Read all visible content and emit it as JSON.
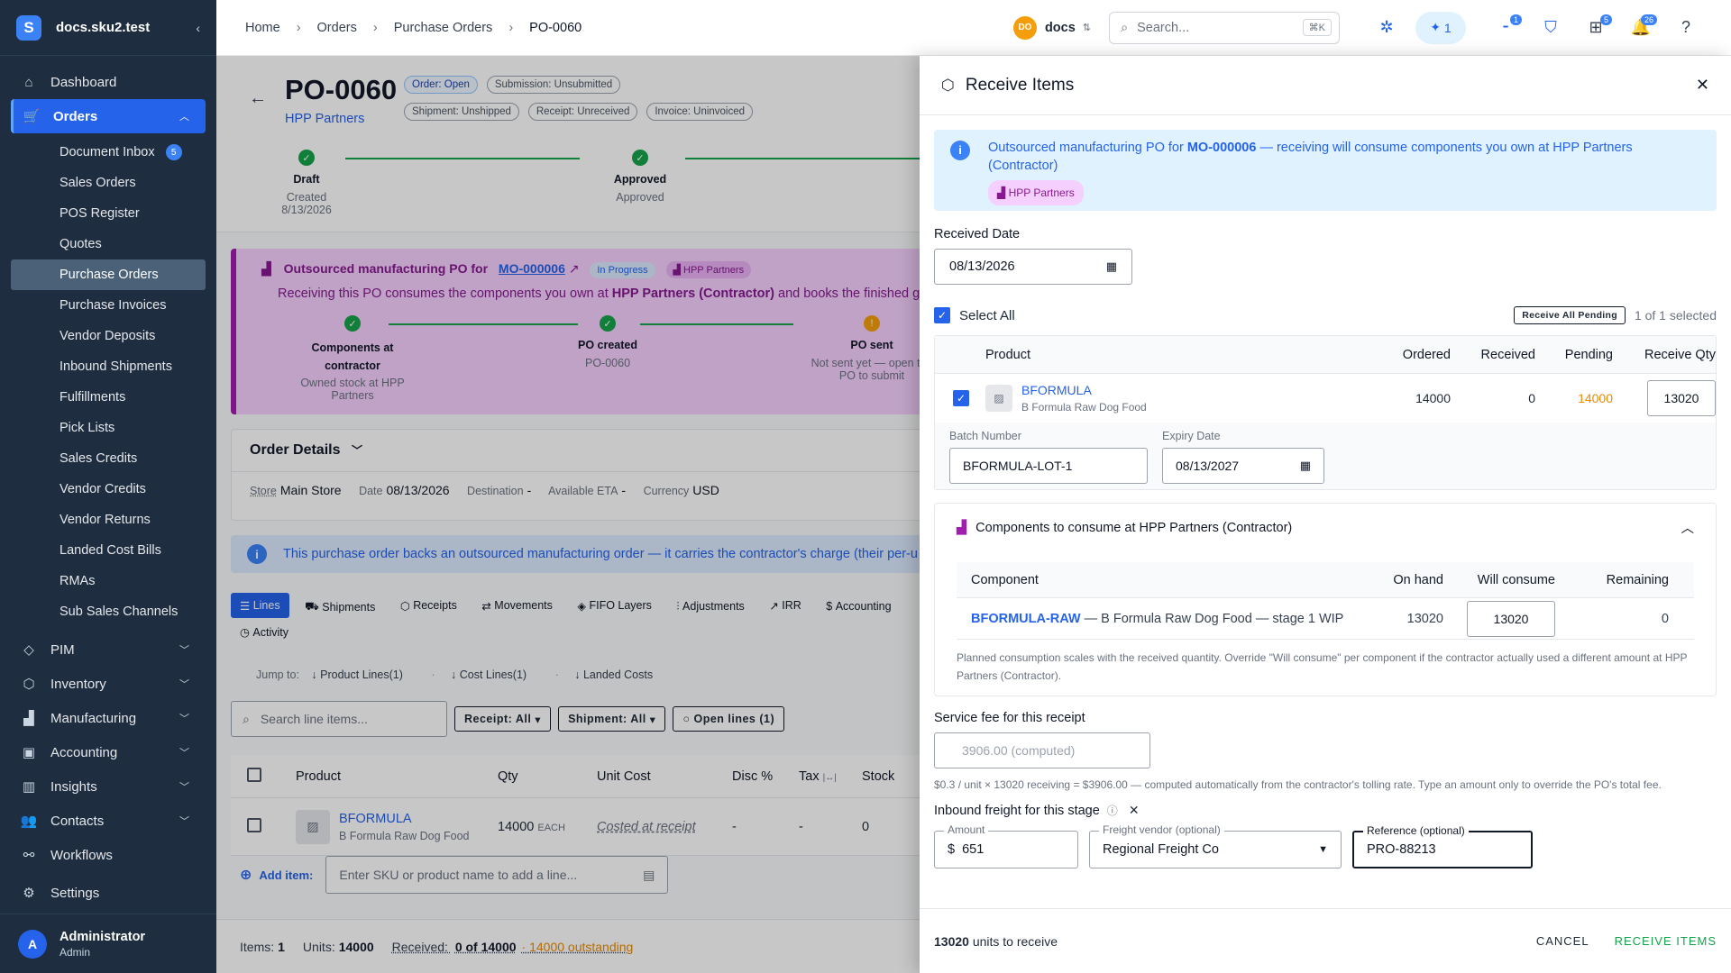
{
  "sidebar": {
    "org": "docs.sku2.test",
    "items": [
      {
        "label": "Dashboard",
        "icon": "home-icon"
      },
      {
        "label": "Orders",
        "icon": "cart-icon"
      },
      {
        "label": "PIM",
        "icon": "tag-icon"
      },
      {
        "label": "Inventory",
        "icon": "box-icon"
      },
      {
        "label": "Manufacturing",
        "icon": "factory-icon"
      },
      {
        "label": "Accounting",
        "icon": "wallet-icon"
      },
      {
        "label": "Insights",
        "icon": "chart-icon"
      },
      {
        "label": "Contacts",
        "icon": "people-icon"
      },
      {
        "label": "Workflows",
        "icon": "workflow-icon"
      },
      {
        "label": "Settings",
        "icon": "gear-icon"
      }
    ],
    "orders_sub": [
      {
        "label": "Document Inbox",
        "badge": "5"
      },
      {
        "label": "Sales Orders"
      },
      {
        "label": "POS Register"
      },
      {
        "label": "Quotes"
      },
      {
        "label": "Purchase Orders"
      },
      {
        "label": "Purchase Invoices"
      },
      {
        "label": "Vendor Deposits"
      },
      {
        "label": "Inbound Shipments"
      },
      {
        "label": "Fulfillments"
      },
      {
        "label": "Pick Lists"
      },
      {
        "label": "Sales Credits"
      },
      {
        "label": "Vendor Credits"
      },
      {
        "label": "Vendor Returns"
      },
      {
        "label": "Landed Cost Bills"
      },
      {
        "label": "RMAs"
      },
      {
        "label": "Sub Sales Channels"
      }
    ],
    "user": {
      "initial": "A",
      "name": "Administrator",
      "role": "Admin"
    }
  },
  "topbar": {
    "breadcrumbs": [
      "Home",
      "Orders",
      "Purchase Orders",
      "PO-0060"
    ],
    "org_initials": "DO",
    "org_name": "docs",
    "search_placeholder": "Search...",
    "search_kbd": "⌘K",
    "ai_count": "1",
    "badge_a": "1",
    "badge_gift": "5",
    "badge_bell": "26"
  },
  "po": {
    "number": "PO-0060",
    "vendor": "HPP Partners",
    "chips": [
      "Order: Open",
      "Submission: Unsubmitted",
      "Shipment: Unshipped",
      "Receipt: Unreceived",
      "Invoice: Uninvoiced"
    ],
    "steps": [
      {
        "title": "Draft",
        "sub1": "Created",
        "sub2": "8/13/2026"
      },
      {
        "title": "Approved",
        "sub1": "Approved",
        "sub2": ""
      }
    ],
    "mfg": {
      "title": "Outsourced manufacturing PO for",
      "mo": "MO-000006",
      "status": "In Progress",
      "contractor": "HPP Partners",
      "desc_a": "Receiving this PO consumes the components you own at",
      "desc_b": "HPP Partners (Contractor)",
      "desc_c": "and books the finished g",
      "steps": [
        {
          "title": "Components at contractor",
          "sub": "Owned stock at HPP Partners"
        },
        {
          "title": "PO created",
          "sub": "PO-0060"
        },
        {
          "title": "PO sent",
          "sub": "Not sent yet — open the PO to submit"
        }
      ]
    },
    "details": {
      "heading": "Order Details",
      "store_label": "Store",
      "store": "Main Store",
      "date_label": "Date",
      "date": "08/13/2026",
      "dest_label": "Destination",
      "dest": "-",
      "eta_label": "Available ETA",
      "eta": "-",
      "currency_label": "Currency",
      "currency": "USD"
    },
    "info": "This purchase order backs an outsourced manufacturing order — it carries the contractor's charge (their per-u",
    "tabs": [
      "Lines",
      "Shipments",
      "Receipts",
      "Movements",
      "FIFO Layers",
      "Adjustments",
      "IRR",
      "Accounting",
      "Activity"
    ],
    "jump_label": "Jump to:",
    "jump": [
      "Product Lines(1)",
      "Cost Lines(1)",
      "Landed Costs"
    ],
    "line_search": "Search line items...",
    "filters": [
      "Receipt: All",
      "Shipment: All",
      "Open lines (1)"
    ],
    "table_head": [
      "Product",
      "Qty",
      "Unit Cost",
      "Disc %",
      "Tax",
      "Stock"
    ],
    "row": {
      "sku": "BFORMULA",
      "name": "B Formula Raw Dog Food",
      "qty": "14000",
      "uom": "EACH",
      "unit_cost": "Costed at receipt",
      "disc": "-",
      "tax": "-",
      "stock": "0"
    },
    "add_item_label": "Add item:",
    "add_item_placeholder": "Enter SKU or product name to add a line...",
    "footer": {
      "items_label": "Items:",
      "items": "1",
      "units_label": "Units:",
      "units": "14000",
      "received_label": "Received:",
      "received": "0 of 14000",
      "outstanding": "· 14000 outstanding"
    }
  },
  "drawer": {
    "title": "Receive Items",
    "info_a": "Outsourced manufacturing PO for",
    "info_mo": "MO-000006",
    "info_b": "— receiving will consume components you own at HPP Partners (Contractor)",
    "info_chip": "HPP Partners",
    "received_date_label": "Received Date",
    "received_date": "08/13/2026",
    "select_all": "Select All",
    "receive_all": "Receive All Pending",
    "selected": "1 of 1 selected",
    "head": [
      "Product",
      "Ordered",
      "Received",
      "Pending",
      "Receive Qty"
    ],
    "row": {
      "sku": "BFORMULA",
      "name": "B Formula Raw Dog Food",
      "ordered": "14000",
      "received": "0",
      "pending": "14000",
      "receive_qty": "13020"
    },
    "batch_label": "Batch Number",
    "batch": "BFORMULA-LOT-1",
    "expiry_label": "Expiry Date",
    "expiry": "08/13/2027",
    "comp_title": "Components to consume at HPP Partners (Contractor)",
    "comp_head": [
      "Component",
      "On hand",
      "Will consume",
      "Remaining"
    ],
    "comp_row": {
      "sku": "BFORMULA-RAW",
      "desc": "— B Formula Raw Dog Food — stage 1 WIP",
      "on_hand": "13020",
      "will_consume": "13020",
      "remaining": "0"
    },
    "comp_note": "Planned consumption scales with the received quantity. Override \"Will consume\" per component if the contractor actually used a different amount at HPP Partners (Contractor).",
    "fee_label": "Service fee for this receipt",
    "fee_placeholder": "3906.00 (computed)",
    "fee_help": "$0.3 / unit × 13020 receiving = $3906.00 — computed automatically from the contractor's tolling rate. Type an amount only to override the PO's total fee.",
    "freight_label": "Inbound freight for this stage",
    "amount_label": "Amount",
    "amount_prefix": "$",
    "amount": "651",
    "vendor_label": "Freight vendor (optional)",
    "vendor": "Regional Freight Co",
    "ref_label": "Reference (optional)",
    "ref": "PRO-88213",
    "units_to_receive": "13020",
    "units_suffix": "units to receive",
    "cancel": "CANCEL",
    "receive": "RECEIVE ITEMS"
  }
}
